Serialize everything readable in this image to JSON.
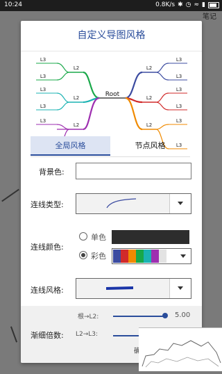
{
  "status_bar": {
    "time": "10:24",
    "net_speed": "0.8K/s",
    "battery": "battery-icon",
    "signal": "signal-icon"
  },
  "background": {
    "note": "笔记"
  },
  "dialog": {
    "title": "自定义导图风格",
    "preview": {
      "root": "Root",
      "l2": [
        "L2",
        "L2",
        "L2",
        "L2",
        "L2",
        "L2"
      ],
      "l3": [
        "L3",
        "L3",
        "L3",
        "L3",
        "L3",
        "L3",
        "L3",
        "L3",
        "L3",
        "L3",
        "L3",
        "L3"
      ]
    },
    "tabs": [
      {
        "label": "全局风格",
        "active": true
      },
      {
        "label": "节点风格",
        "active": false
      }
    ],
    "fields": {
      "background_color": {
        "label": "背景色:",
        "value": ""
      },
      "line_type": {
        "label": "连线类型:",
        "icon": "curve-line-icon"
      },
      "line_color": {
        "label": "连线颜色:",
        "options": [
          {
            "label": "单色",
            "selected": false,
            "color": "#2d2d2d"
          },
          {
            "label": "彩色",
            "selected": true
          }
        ],
        "palette": [
          "#3b4ba0",
          "#d12a2a",
          "#f08a00",
          "#18a84a",
          "#1bb3b3",
          "#9e2fb0",
          "#e3e3e3"
        ]
      },
      "line_style": {
        "label": "连线风格:",
        "icon": "taper-line-icon"
      },
      "taper": {
        "label": "渐细倍数:",
        "sliders": [
          {
            "label": "根→L2:",
            "value": "5.00",
            "level": 1.0
          },
          {
            "label": "L2→L3:",
            "value": "",
            "level": 0.6
          }
        ]
      }
    },
    "ok_button": "确"
  }
}
